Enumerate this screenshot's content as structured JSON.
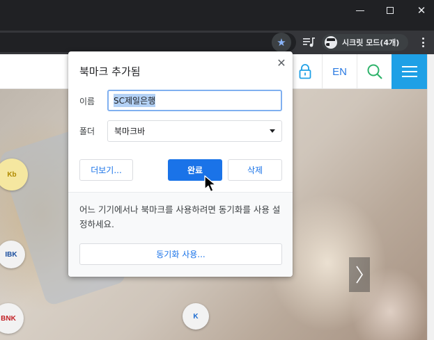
{
  "window": {
    "minimize_icon": "minimize-icon",
    "maximize_icon": "maximize-icon",
    "close_symbol": "✕"
  },
  "toolbar": {
    "bookmark_star_icon": "star-icon",
    "bookmark_star_symbol": "★",
    "playlist_icon": "playlist-icon",
    "profile_label": "시크릿 모드(4개)",
    "menu_icon": "more-vert-icon"
  },
  "site_header": {
    "lock_icon": "lock-icon",
    "language_label": "EN",
    "search_icon": "search-icon",
    "menu_icon": "hamburger-menu-icon",
    "accent_color": "#1ea0e6"
  },
  "hero": {
    "coins": [
      "Kb",
      "BNK",
      "IBK",
      "K"
    ],
    "next_icon": "chevron-right-icon"
  },
  "bookmark_dialog": {
    "title": "북마크 추가됨",
    "close_symbol": "✕",
    "name_label": "이름",
    "name_value": "SC제일은행",
    "folder_label": "폴더",
    "folder_value": "북마크바",
    "more_button": "더보기...",
    "done_button": "완료",
    "remove_button": "삭제",
    "sync_message": "어느 기기에서나 북마크를 사용하려면 동기화를 사용 설정하세요.",
    "sync_button": "동기화 사용...",
    "primary_color": "#1a73e8"
  }
}
